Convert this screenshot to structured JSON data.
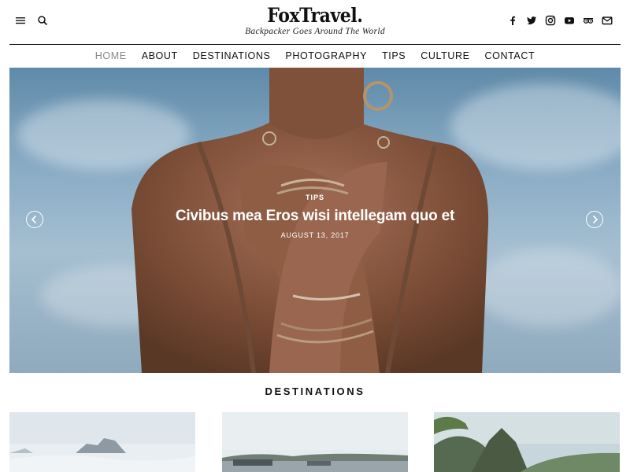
{
  "site": {
    "name": "FoxTravel.",
    "tagline": "Backpacker Goes Around The World"
  },
  "header": {
    "left_icons": [
      "menu-icon",
      "search-icon"
    ],
    "social_icons": [
      "facebook-icon",
      "twitter-icon",
      "instagram-icon",
      "youtube-icon",
      "tripadvisor-icon",
      "email-icon"
    ]
  },
  "nav": {
    "items": [
      {
        "label": "HOME",
        "active": true
      },
      {
        "label": "ABOUT"
      },
      {
        "label": "DESTINATIONS"
      },
      {
        "label": "PHOTOGRAPHY"
      },
      {
        "label": "TIPS"
      },
      {
        "label": "CULTURE"
      },
      {
        "label": "CONTACT"
      }
    ]
  },
  "hero": {
    "category": "TIPS",
    "title": "Civibus mea Eros wisi intellegam quo et",
    "date": "AUGUST 13, 2017"
  },
  "section": {
    "title": "DESTINATIONS"
  },
  "colors": {
    "text": "#111111",
    "nav_active": "#888888",
    "sky": "#86a9c3",
    "skin": "#8a5a3e"
  }
}
